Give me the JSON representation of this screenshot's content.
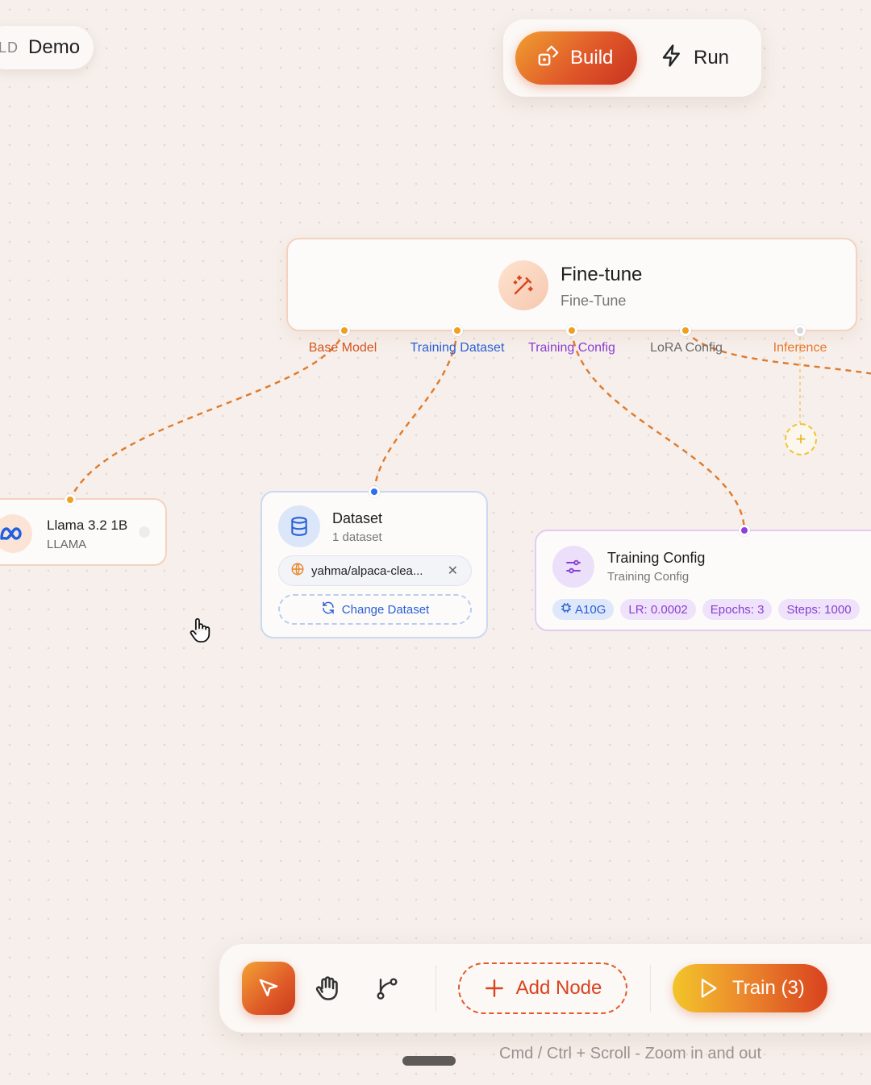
{
  "project": {
    "prefix": "LD",
    "name": "Demo"
  },
  "modes": {
    "build": "Build",
    "run": "Run",
    "active": "build"
  },
  "nodes": {
    "finetune": {
      "title": "Fine-tune",
      "subtitle": "Fine-Tune",
      "ports": [
        "Base Model",
        "Training Dataset",
        "Training Config",
        "LoRA Config",
        "Inference"
      ]
    },
    "llama": {
      "title": "Llama 3.2 1B",
      "subtitle": "LLAMA",
      "logo": "meta-logo"
    },
    "dataset": {
      "title": "Dataset",
      "subtitle": "1 dataset",
      "selected": "yahma/alpaca-clea...",
      "change_label": "Change Dataset"
    },
    "training_config": {
      "title": "Training Config",
      "subtitle": "Training Config",
      "gpu": "A10G",
      "lr": "LR: 0.0002",
      "epochs": "Epochs: 3",
      "steps": "Steps: 1000"
    }
  },
  "toolbar": {
    "tools": [
      "pointer-icon",
      "hand-icon",
      "branch-icon"
    ],
    "add_node": "Add Node",
    "train": "Train (3)"
  },
  "hint": "Cmd / Ctrl + Scroll - Zoom in and out",
  "colors": {
    "accent": "#e35a2a",
    "port_orange": "#f0a020",
    "port_blue": "#2b6ff0",
    "port_purple": "#9040d8",
    "port_inactive": "#d8d8d8"
  }
}
